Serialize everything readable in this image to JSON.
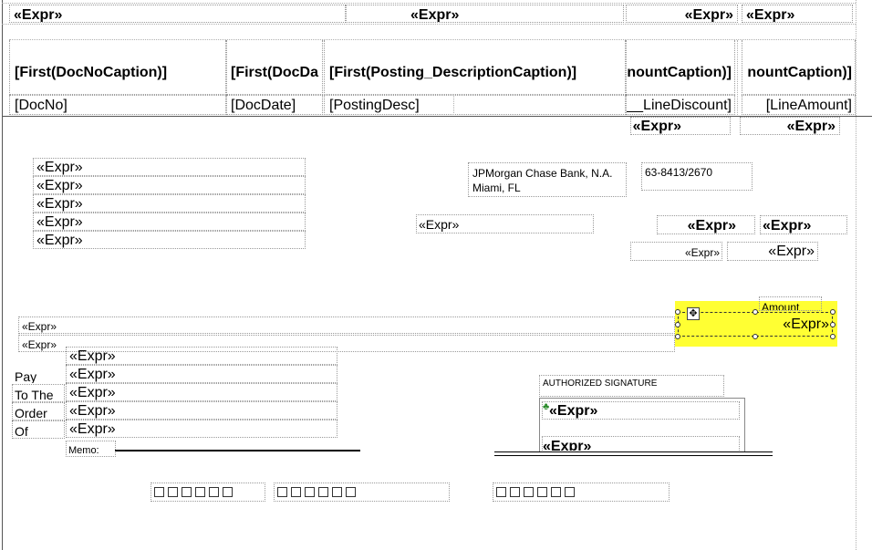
{
  "expr": "«Expr»",
  "header": {
    "doc_no_caption": "[First(DocNoCaption)]",
    "doc_date_caption": "[First(DocDa",
    "posting_desc_caption": "[First(Posting_DescriptionCaption)]",
    "line_discount_caption": "nountCaption)]",
    "line_amount_caption": "nountCaption)]"
  },
  "row": {
    "doc_no": "[DocNo]",
    "doc_date": "[DocDate]",
    "posting_desc": "[PostingDesc]",
    "line_discount": "__LineDiscount]",
    "line_amount": "[LineAmount]"
  },
  "bank": {
    "name": "JPMorgan Chase Bank, N.A.",
    "city": "Miami, FL",
    "routing": "63-8413/2670"
  },
  "labels": {
    "amount": "Amount",
    "pay": "Pay",
    "to_the": "To The",
    "order": "Order",
    "of": "Of",
    "memo": "Memo:",
    "authorized_signature": "AUTHORIZED SIGNATURE"
  },
  "micr_boxes": 6,
  "colors": {
    "selection_highlight": "#ffff33",
    "border_dotted": "#9a9a9a"
  }
}
